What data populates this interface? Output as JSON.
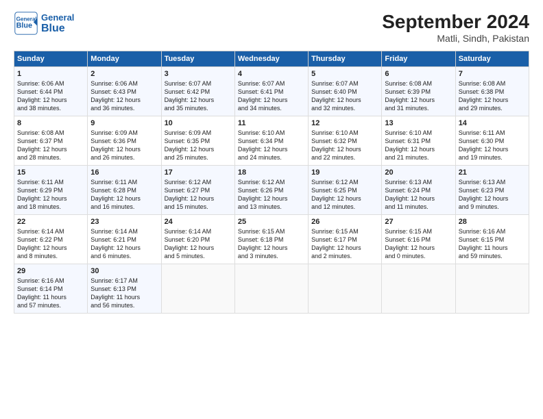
{
  "header": {
    "logo_general": "General",
    "logo_blue": "Blue",
    "title": "September 2024",
    "subtitle": "Matli, Sindh, Pakistan"
  },
  "columns": [
    "Sunday",
    "Monday",
    "Tuesday",
    "Wednesday",
    "Thursday",
    "Friday",
    "Saturday"
  ],
  "rows": [
    [
      {
        "day": "1",
        "lines": [
          "Sunrise: 6:06 AM",
          "Sunset: 6:44 PM",
          "Daylight: 12 hours",
          "and 38 minutes."
        ]
      },
      {
        "day": "2",
        "lines": [
          "Sunrise: 6:06 AM",
          "Sunset: 6:43 PM",
          "Daylight: 12 hours",
          "and 36 minutes."
        ]
      },
      {
        "day": "3",
        "lines": [
          "Sunrise: 6:07 AM",
          "Sunset: 6:42 PM",
          "Daylight: 12 hours",
          "and 35 minutes."
        ]
      },
      {
        "day": "4",
        "lines": [
          "Sunrise: 6:07 AM",
          "Sunset: 6:41 PM",
          "Daylight: 12 hours",
          "and 34 minutes."
        ]
      },
      {
        "day": "5",
        "lines": [
          "Sunrise: 6:07 AM",
          "Sunset: 6:40 PM",
          "Daylight: 12 hours",
          "and 32 minutes."
        ]
      },
      {
        "day": "6",
        "lines": [
          "Sunrise: 6:08 AM",
          "Sunset: 6:39 PM",
          "Daylight: 12 hours",
          "and 31 minutes."
        ]
      },
      {
        "day": "7",
        "lines": [
          "Sunrise: 6:08 AM",
          "Sunset: 6:38 PM",
          "Daylight: 12 hours",
          "and 29 minutes."
        ]
      }
    ],
    [
      {
        "day": "8",
        "lines": [
          "Sunrise: 6:08 AM",
          "Sunset: 6:37 PM",
          "Daylight: 12 hours",
          "and 28 minutes."
        ]
      },
      {
        "day": "9",
        "lines": [
          "Sunrise: 6:09 AM",
          "Sunset: 6:36 PM",
          "Daylight: 12 hours",
          "and 26 minutes."
        ]
      },
      {
        "day": "10",
        "lines": [
          "Sunrise: 6:09 AM",
          "Sunset: 6:35 PM",
          "Daylight: 12 hours",
          "and 25 minutes."
        ]
      },
      {
        "day": "11",
        "lines": [
          "Sunrise: 6:10 AM",
          "Sunset: 6:34 PM",
          "Daylight: 12 hours",
          "and 24 minutes."
        ]
      },
      {
        "day": "12",
        "lines": [
          "Sunrise: 6:10 AM",
          "Sunset: 6:32 PM",
          "Daylight: 12 hours",
          "and 22 minutes."
        ]
      },
      {
        "day": "13",
        "lines": [
          "Sunrise: 6:10 AM",
          "Sunset: 6:31 PM",
          "Daylight: 12 hours",
          "and 21 minutes."
        ]
      },
      {
        "day": "14",
        "lines": [
          "Sunrise: 6:11 AM",
          "Sunset: 6:30 PM",
          "Daylight: 12 hours",
          "and 19 minutes."
        ]
      }
    ],
    [
      {
        "day": "15",
        "lines": [
          "Sunrise: 6:11 AM",
          "Sunset: 6:29 PM",
          "Daylight: 12 hours",
          "and 18 minutes."
        ]
      },
      {
        "day": "16",
        "lines": [
          "Sunrise: 6:11 AM",
          "Sunset: 6:28 PM",
          "Daylight: 12 hours",
          "and 16 minutes."
        ]
      },
      {
        "day": "17",
        "lines": [
          "Sunrise: 6:12 AM",
          "Sunset: 6:27 PM",
          "Daylight: 12 hours",
          "and 15 minutes."
        ]
      },
      {
        "day": "18",
        "lines": [
          "Sunrise: 6:12 AM",
          "Sunset: 6:26 PM",
          "Daylight: 12 hours",
          "and 13 minutes."
        ]
      },
      {
        "day": "19",
        "lines": [
          "Sunrise: 6:12 AM",
          "Sunset: 6:25 PM",
          "Daylight: 12 hours",
          "and 12 minutes."
        ]
      },
      {
        "day": "20",
        "lines": [
          "Sunrise: 6:13 AM",
          "Sunset: 6:24 PM",
          "Daylight: 12 hours",
          "and 11 minutes."
        ]
      },
      {
        "day": "21",
        "lines": [
          "Sunrise: 6:13 AM",
          "Sunset: 6:23 PM",
          "Daylight: 12 hours",
          "and 9 minutes."
        ]
      }
    ],
    [
      {
        "day": "22",
        "lines": [
          "Sunrise: 6:14 AM",
          "Sunset: 6:22 PM",
          "Daylight: 12 hours",
          "and 8 minutes."
        ]
      },
      {
        "day": "23",
        "lines": [
          "Sunrise: 6:14 AM",
          "Sunset: 6:21 PM",
          "Daylight: 12 hours",
          "and 6 minutes."
        ]
      },
      {
        "day": "24",
        "lines": [
          "Sunrise: 6:14 AM",
          "Sunset: 6:20 PM",
          "Daylight: 12 hours",
          "and 5 minutes."
        ]
      },
      {
        "day": "25",
        "lines": [
          "Sunrise: 6:15 AM",
          "Sunset: 6:18 PM",
          "Daylight: 12 hours",
          "and 3 minutes."
        ]
      },
      {
        "day": "26",
        "lines": [
          "Sunrise: 6:15 AM",
          "Sunset: 6:17 PM",
          "Daylight: 12 hours",
          "and 2 minutes."
        ]
      },
      {
        "day": "27",
        "lines": [
          "Sunrise: 6:15 AM",
          "Sunset: 6:16 PM",
          "Daylight: 12 hours",
          "and 0 minutes."
        ]
      },
      {
        "day": "28",
        "lines": [
          "Sunrise: 6:16 AM",
          "Sunset: 6:15 PM",
          "Daylight: 11 hours",
          "and 59 minutes."
        ]
      }
    ],
    [
      {
        "day": "29",
        "lines": [
          "Sunrise: 6:16 AM",
          "Sunset: 6:14 PM",
          "Daylight: 11 hours",
          "and 57 minutes."
        ]
      },
      {
        "day": "30",
        "lines": [
          "Sunrise: 6:17 AM",
          "Sunset: 6:13 PM",
          "Daylight: 11 hours",
          "and 56 minutes."
        ]
      },
      {
        "day": "",
        "lines": []
      },
      {
        "day": "",
        "lines": []
      },
      {
        "day": "",
        "lines": []
      },
      {
        "day": "",
        "lines": []
      },
      {
        "day": "",
        "lines": []
      }
    ]
  ]
}
